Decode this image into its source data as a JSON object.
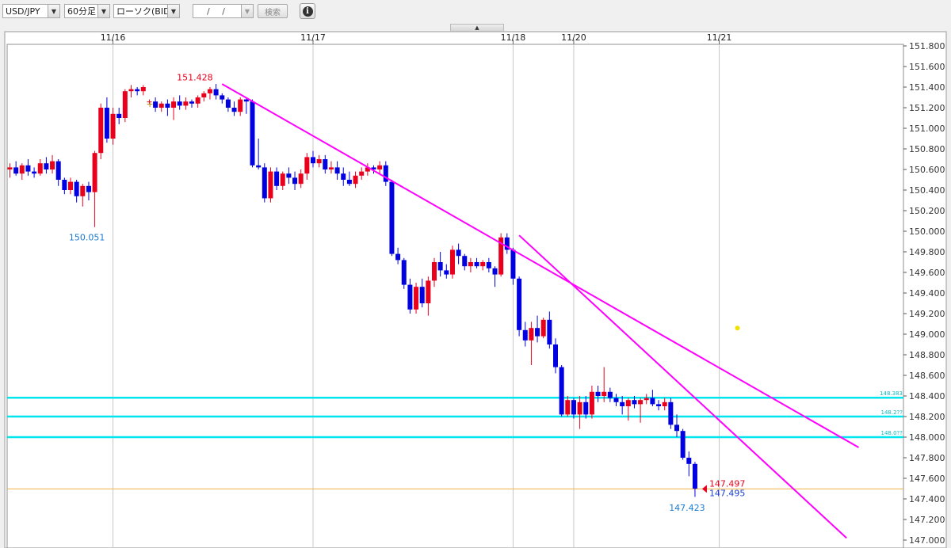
{
  "toolbar": {
    "pair": "USD/JPY",
    "timeframe": "60分足",
    "chart_kind": "ローソク(BID)",
    "date_input": "/ /",
    "search_label": "検索",
    "info_icon": "info-icon",
    "dropdown_icon": "▼",
    "collapse_icon": "▲"
  },
  "colors": {
    "up": "#e8001c",
    "down": "#0000e0",
    "trendline": "#ff00ff",
    "hline": "#00e5ee",
    "current_line": "#f0b040",
    "grid": "#c8c8c8"
  },
  "chart_data": {
    "type": "candlestick",
    "ylim": [
      147.1,
      151.85
    ],
    "y_ticks": [
      "151.800",
      "151.600",
      "151.400",
      "151.200",
      "151.000",
      "150.800",
      "150.600",
      "150.400",
      "150.200",
      "150.000",
      "149.800",
      "149.600",
      "149.400",
      "149.200",
      "149.000",
      "148.800",
      "148.600",
      "148.400",
      "148.200",
      "148.000",
      "147.800",
      "147.600",
      "147.400",
      "147.200",
      "147.000"
    ],
    "x_dates": [
      {
        "label": "11/16",
        "index": 17
      },
      {
        "label": "11/17",
        "index": 50
      },
      {
        "label": "11/18",
        "index": 83
      },
      {
        "label": "11/20",
        "index": 93
      },
      {
        "label": "11/21",
        "index": 117
      }
    ],
    "candles": [
      [
        150.6,
        150.66,
        150.52,
        150.62
      ],
      [
        150.62,
        150.68,
        150.54,
        150.56
      ],
      [
        150.56,
        150.66,
        150.5,
        150.64
      ],
      [
        150.64,
        150.7,
        150.54,
        150.58
      ],
      [
        150.58,
        150.62,
        150.52,
        150.56
      ],
      [
        150.56,
        150.7,
        150.54,
        150.66
      ],
      [
        150.66,
        150.72,
        150.56,
        150.6
      ],
      [
        150.6,
        150.74,
        150.56,
        150.68
      ],
      [
        150.68,
        150.7,
        150.44,
        150.5
      ],
      [
        150.5,
        150.52,
        150.36,
        150.4
      ],
      [
        150.4,
        150.52,
        150.36,
        150.48
      ],
      [
        150.48,
        150.5,
        150.28,
        150.34
      ],
      [
        150.34,
        150.46,
        150.24,
        150.44
      ],
      [
        150.44,
        150.48,
        150.3,
        150.38
      ],
      [
        150.38,
        150.78,
        150.04,
        150.76
      ],
      [
        150.76,
        151.24,
        150.7,
        151.2
      ],
      [
        151.2,
        151.3,
        150.86,
        150.9
      ],
      [
        150.9,
        151.2,
        150.84,
        151.14
      ],
      [
        151.14,
        151.2,
        151.04,
        151.1
      ],
      [
        151.1,
        151.38,
        151.06,
        151.36
      ],
      [
        151.36,
        151.42,
        151.3,
        151.38
      ],
      [
        151.38,
        151.4,
        151.32,
        151.36
      ],
      [
        151.36,
        151.42,
        151.32,
        151.4
      ],
      [
        151.26,
        151.28,
        151.24,
        151.26
      ],
      [
        151.26,
        151.3,
        151.16,
        151.2
      ],
      [
        151.2,
        151.26,
        151.16,
        151.24
      ],
      [
        151.24,
        151.28,
        151.12,
        151.2
      ],
      [
        151.2,
        151.3,
        151.08,
        151.26
      ],
      [
        151.26,
        151.32,
        151.18,
        151.22
      ],
      [
        151.22,
        151.3,
        151.18,
        151.26
      ],
      [
        151.26,
        151.28,
        151.2,
        151.24
      ],
      [
        151.24,
        151.32,
        151.2,
        151.3
      ],
      [
        151.3,
        151.36,
        151.26,
        151.34
      ],
      [
        151.34,
        151.4,
        151.28,
        151.38
      ],
      [
        151.38,
        151.43,
        151.28,
        151.32
      ],
      [
        151.32,
        151.34,
        151.24,
        151.28
      ],
      [
        151.28,
        151.3,
        151.16,
        151.2
      ],
      [
        151.2,
        151.26,
        151.12,
        151.16
      ],
      [
        151.16,
        151.3,
        151.12,
        151.28
      ],
      [
        151.28,
        151.3,
        151.14,
        151.26
      ],
      [
        151.26,
        151.28,
        150.62,
        150.64
      ],
      [
        150.64,
        150.9,
        150.6,
        150.62
      ],
      [
        150.62,
        150.66,
        150.28,
        150.32
      ],
      [
        150.32,
        150.62,
        150.28,
        150.58
      ],
      [
        150.58,
        150.62,
        150.4,
        150.44
      ],
      [
        150.44,
        150.58,
        150.4,
        150.56
      ],
      [
        150.56,
        150.62,
        150.46,
        150.52
      ],
      [
        150.52,
        150.58,
        150.4,
        150.46
      ],
      [
        150.46,
        150.6,
        150.42,
        150.56
      ],
      [
        150.56,
        150.76,
        150.5,
        150.72
      ],
      [
        150.72,
        150.78,
        150.62,
        150.66
      ],
      [
        150.66,
        150.74,
        150.62,
        150.7
      ],
      [
        150.7,
        150.74,
        150.56,
        150.6
      ],
      [
        150.6,
        150.68,
        150.56,
        150.62
      ],
      [
        150.62,
        150.68,
        150.5,
        150.56
      ],
      [
        150.56,
        150.62,
        150.44,
        150.5
      ],
      [
        150.5,
        150.58,
        150.44,
        150.46
      ],
      [
        150.46,
        150.58,
        150.42,
        150.54
      ],
      [
        150.54,
        150.62,
        150.5,
        150.58
      ],
      [
        150.58,
        150.66,
        150.54,
        150.62
      ],
      [
        150.62,
        150.64,
        150.56,
        150.6
      ],
      [
        150.6,
        150.68,
        150.56,
        150.64
      ],
      [
        150.64,
        150.68,
        150.44,
        150.48
      ],
      [
        150.48,
        150.5,
        149.76,
        149.78
      ],
      [
        149.78,
        149.84,
        149.68,
        149.72
      ],
      [
        149.72,
        149.74,
        149.44,
        149.48
      ],
      [
        149.48,
        149.54,
        149.2,
        149.24
      ],
      [
        149.24,
        149.5,
        149.2,
        149.46
      ],
      [
        149.46,
        149.54,
        149.26,
        149.3
      ],
      [
        149.3,
        149.56,
        149.18,
        149.52
      ],
      [
        149.52,
        149.74,
        149.46,
        149.7
      ],
      [
        149.7,
        149.8,
        149.56,
        149.62
      ],
      [
        149.62,
        149.68,
        149.54,
        149.58
      ],
      [
        149.58,
        149.86,
        149.54,
        149.82
      ],
      [
        149.82,
        149.88,
        149.68,
        149.76
      ],
      [
        149.76,
        149.78,
        149.62,
        149.66
      ],
      [
        149.66,
        149.74,
        149.6,
        149.7
      ],
      [
        149.7,
        149.74,
        149.64,
        149.66
      ],
      [
        149.66,
        149.72,
        149.62,
        149.7
      ],
      [
        149.7,
        149.74,
        149.6,
        149.64
      ],
      [
        149.64,
        149.66,
        149.46,
        149.58
      ],
      [
        149.58,
        149.98,
        149.56,
        149.94
      ],
      [
        149.94,
        149.98,
        149.78,
        149.82
      ],
      [
        149.82,
        149.84,
        149.48,
        149.54
      ],
      [
        149.54,
        149.56,
        148.98,
        149.04
      ],
      [
        149.04,
        149.12,
        148.88,
        148.94
      ],
      [
        148.94,
        149.12,
        148.7,
        149.06
      ],
      [
        149.06,
        149.18,
        148.92,
        148.98
      ],
      [
        148.98,
        149.16,
        148.96,
        149.14
      ],
      [
        149.14,
        149.22,
        148.86,
        148.9
      ],
      [
        148.9,
        148.96,
        148.62,
        148.68
      ],
      [
        148.68,
        148.7,
        148.2,
        148.22
      ],
      [
        148.22,
        148.4,
        148.2,
        148.36
      ],
      [
        148.36,
        148.38,
        148.18,
        148.22
      ],
      [
        148.22,
        148.4,
        148.08,
        148.34
      ],
      [
        148.34,
        148.4,
        148.18,
        148.22
      ],
      [
        148.22,
        148.5,
        148.18,
        148.44
      ],
      [
        148.44,
        148.5,
        148.34,
        148.4
      ],
      [
        148.4,
        148.68,
        148.34,
        148.44
      ],
      [
        148.44,
        148.48,
        148.34,
        148.38
      ],
      [
        148.38,
        148.42,
        148.3,
        148.34
      ],
      [
        148.34,
        148.4,
        148.22,
        148.3
      ],
      [
        148.3,
        148.38,
        148.16,
        148.36
      ],
      [
        148.36,
        148.4,
        148.28,
        148.32
      ],
      [
        148.32,
        148.38,
        148.14,
        148.36
      ],
      [
        148.36,
        148.42,
        148.32,
        148.38
      ],
      [
        148.38,
        148.46,
        148.3,
        148.32
      ],
      [
        148.32,
        148.36,
        148.26,
        148.3
      ],
      [
        148.3,
        148.38,
        148.26,
        148.34
      ],
      [
        148.34,
        148.38,
        148.08,
        148.12
      ],
      [
        148.12,
        148.22,
        148.0,
        148.06
      ],
      [
        148.06,
        148.08,
        147.78,
        147.8
      ],
      [
        147.8,
        147.86,
        147.62,
        147.74
      ],
      [
        147.74,
        147.76,
        147.42,
        147.5
      ]
    ],
    "annotations": [
      {
        "text": "151.428",
        "kind": "high",
        "index": 34,
        "price": 151.428
      },
      {
        "text": "150.051",
        "kind": "low",
        "index": 14,
        "price": 150.051
      },
      {
        "text": "147.423",
        "kind": "low",
        "index": 113,
        "price": 147.423
      }
    ],
    "horizontal_lines": [
      {
        "price": 148.383,
        "label": "148.383"
      },
      {
        "price": 148.2,
        "label": "148.2??"
      },
      {
        "price": 148.0,
        "label": "148.0??"
      }
    ],
    "current_price": {
      "ask": "147.497",
      "bid": "147.495",
      "price": 147.497
    },
    "trendlines": [
      {
        "from": {
          "index": 35,
          "price": 151.43
        },
        "to": {
          "index": 140,
          "price": 147.9
        }
      },
      {
        "from": {
          "index": 84,
          "price": 149.96
        },
        "to": {
          "index": 138,
          "price": 147.02
        }
      }
    ],
    "marker_dot": {
      "index": 120,
      "price": 149.06
    }
  }
}
